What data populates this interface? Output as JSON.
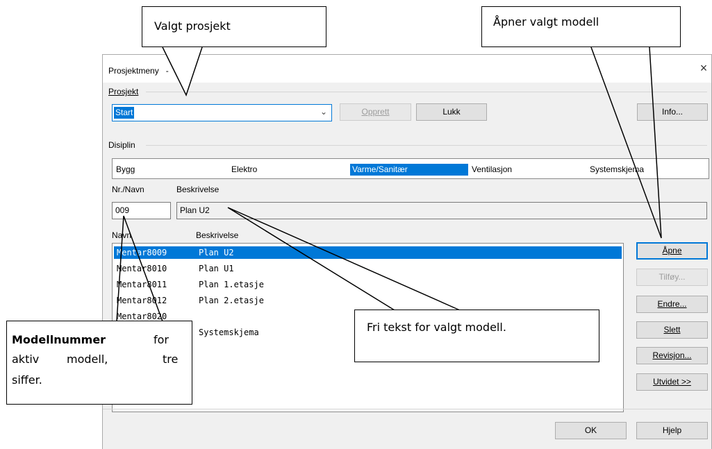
{
  "window": {
    "title": "Prosjektmeny   -   Start",
    "close_glyph": "×"
  },
  "prosjekt": {
    "group_label": "Prosjekt",
    "selected": "Start",
    "buttons": {
      "opprett": "Opprett",
      "lukk": "Lukk",
      "info": "Info..."
    }
  },
  "disiplin": {
    "group_label": "Disiplin",
    "items": [
      "Bygg",
      "Elektro",
      "Varme/Sanitær",
      "Ventilasjon",
      "Systemskjema"
    ],
    "selected_index": 2
  },
  "model": {
    "nr_label": "Nr./Navn",
    "desc_label": "Beskrivelse",
    "nr_value": "009",
    "desc_value": "Plan U2"
  },
  "list": {
    "col_navn": "Navn",
    "col_beskrivelse": "Beskrivelse",
    "rows": [
      {
        "navn": "Mentar8009",
        "beskrivelse": "Plan U2"
      },
      {
        "navn": "Mentar8010",
        "beskrivelse": "Plan U1"
      },
      {
        "navn": "Mentar8011",
        "beskrivelse": "Plan 1.etasje"
      },
      {
        "navn": "Mentar8012",
        "beskrivelse": "Plan 2.etasje"
      },
      {
        "navn": "Mentar8020",
        "beskrivelse": ""
      },
      {
        "navn": "",
        "beskrivelse": "Systemskjema"
      }
    ],
    "selected_index": 0
  },
  "side_buttons": {
    "apne": "Åpne",
    "tilfoy": "Tilføy...",
    "endre": "Endre...",
    "slett": "Slett",
    "revisjon": "Revisjon...",
    "utvidet": "Utvidet >>"
  },
  "footer": {
    "ok": "OK",
    "hjelp": "Hjelp"
  },
  "callouts": {
    "valgt_prosjekt": "Valgt prosjekt",
    "apner": "Åpner valgt modell",
    "fritekst": "Fri tekst for valgt modell.",
    "modell_bold": "Modellnummer",
    "modell_l1_rest": "for",
    "modell_l2a": "aktiv",
    "modell_l2b": "modell,",
    "modell_l2c": "tre",
    "modell_l3": "siffer."
  }
}
